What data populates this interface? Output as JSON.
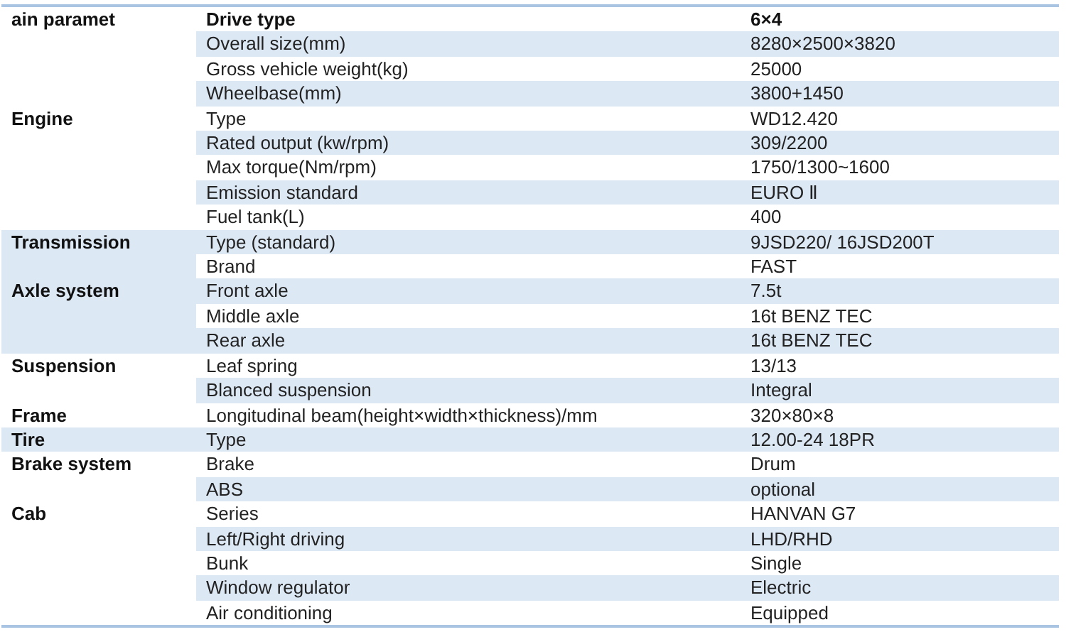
{
  "spec_table": {
    "groups": [
      {
        "label": "ain paramet",
        "rows": [
          {
            "kind": "header",
            "parameter": "Drive type",
            "value": "6×4"
          },
          {
            "kind": "spec",
            "parameter": "Overall size(mm)",
            "value": "8280×2500×3820"
          },
          {
            "kind": "spec",
            "parameter": "Gross vehicle weight(kg)",
            "value": "25000"
          },
          {
            "kind": "spec",
            "parameter": "Wheelbase(mm)",
            "value": "3800+1450"
          }
        ]
      },
      {
        "label": "Engine",
        "rows": [
          {
            "kind": "spec",
            "parameter": "Type",
            "value": "WD12.420"
          },
          {
            "kind": "spec",
            "parameter": "Rated output (kw/rpm)",
            "value": "309/2200"
          },
          {
            "kind": "spec",
            "parameter": "Max torque(Nm/rpm)",
            "value": "1750/1300~1600"
          },
          {
            "kind": "spec",
            "parameter": "Emission standard",
            "value": "EURO Ⅱ"
          },
          {
            "kind": "spec",
            "parameter": "Fuel tank(L)",
            "value": "400"
          }
        ]
      },
      {
        "label": "Transmission",
        "rows": [
          {
            "kind": "spec",
            "parameter": "Type (standard)",
            "value": "9JSD220/ 16JSD200T"
          },
          {
            "kind": "spec",
            "parameter": "Brand",
            "value": "FAST"
          }
        ]
      },
      {
        "label": "Axle system",
        "rows": [
          {
            "kind": "spec",
            "parameter": "Front axle",
            "value": "7.5t"
          },
          {
            "kind": "spec",
            "parameter": "Middle axle",
            "value": "16t BENZ TEC"
          },
          {
            "kind": "spec",
            "parameter": "Rear axle",
            "value": "16t BENZ TEC"
          }
        ]
      },
      {
        "label": "Suspension",
        "rows": [
          {
            "kind": "spec",
            "parameter": "Leaf spring",
            "value": "13/13"
          },
          {
            "kind": "spec",
            "parameter": "Blanced suspension",
            "value": "Integral"
          }
        ]
      },
      {
        "label": "Frame",
        "rows": [
          {
            "kind": "spec",
            "parameter": "Longitudinal beam(height×width×thickness)/mm",
            "value": "320×80×8"
          }
        ]
      },
      {
        "label": "Tire",
        "rows": [
          {
            "kind": "spec",
            "parameter": "Type",
            "value": "12.00-24 18PR"
          }
        ]
      },
      {
        "label": "Brake system",
        "rows": [
          {
            "kind": "spec",
            "parameter": "Brake",
            "value": "Drum"
          },
          {
            "kind": "spec",
            "parameter": "ABS",
            "value": "optional"
          }
        ]
      },
      {
        "label": "Cab",
        "rows": [
          {
            "kind": "spec",
            "parameter": "Series",
            "value": "HANVAN G7"
          },
          {
            "kind": "spec",
            "parameter": "Left/Right driving",
            "value": "LHD/RHD"
          },
          {
            "kind": "spec",
            "parameter": "Bunk",
            "value": "Single"
          },
          {
            "kind": "spec",
            "parameter": "Window regulator",
            "value": "Electric"
          },
          {
            "kind": "spec",
            "parameter": "Air conditioning",
            "value": "Equipped"
          }
        ]
      }
    ]
  }
}
